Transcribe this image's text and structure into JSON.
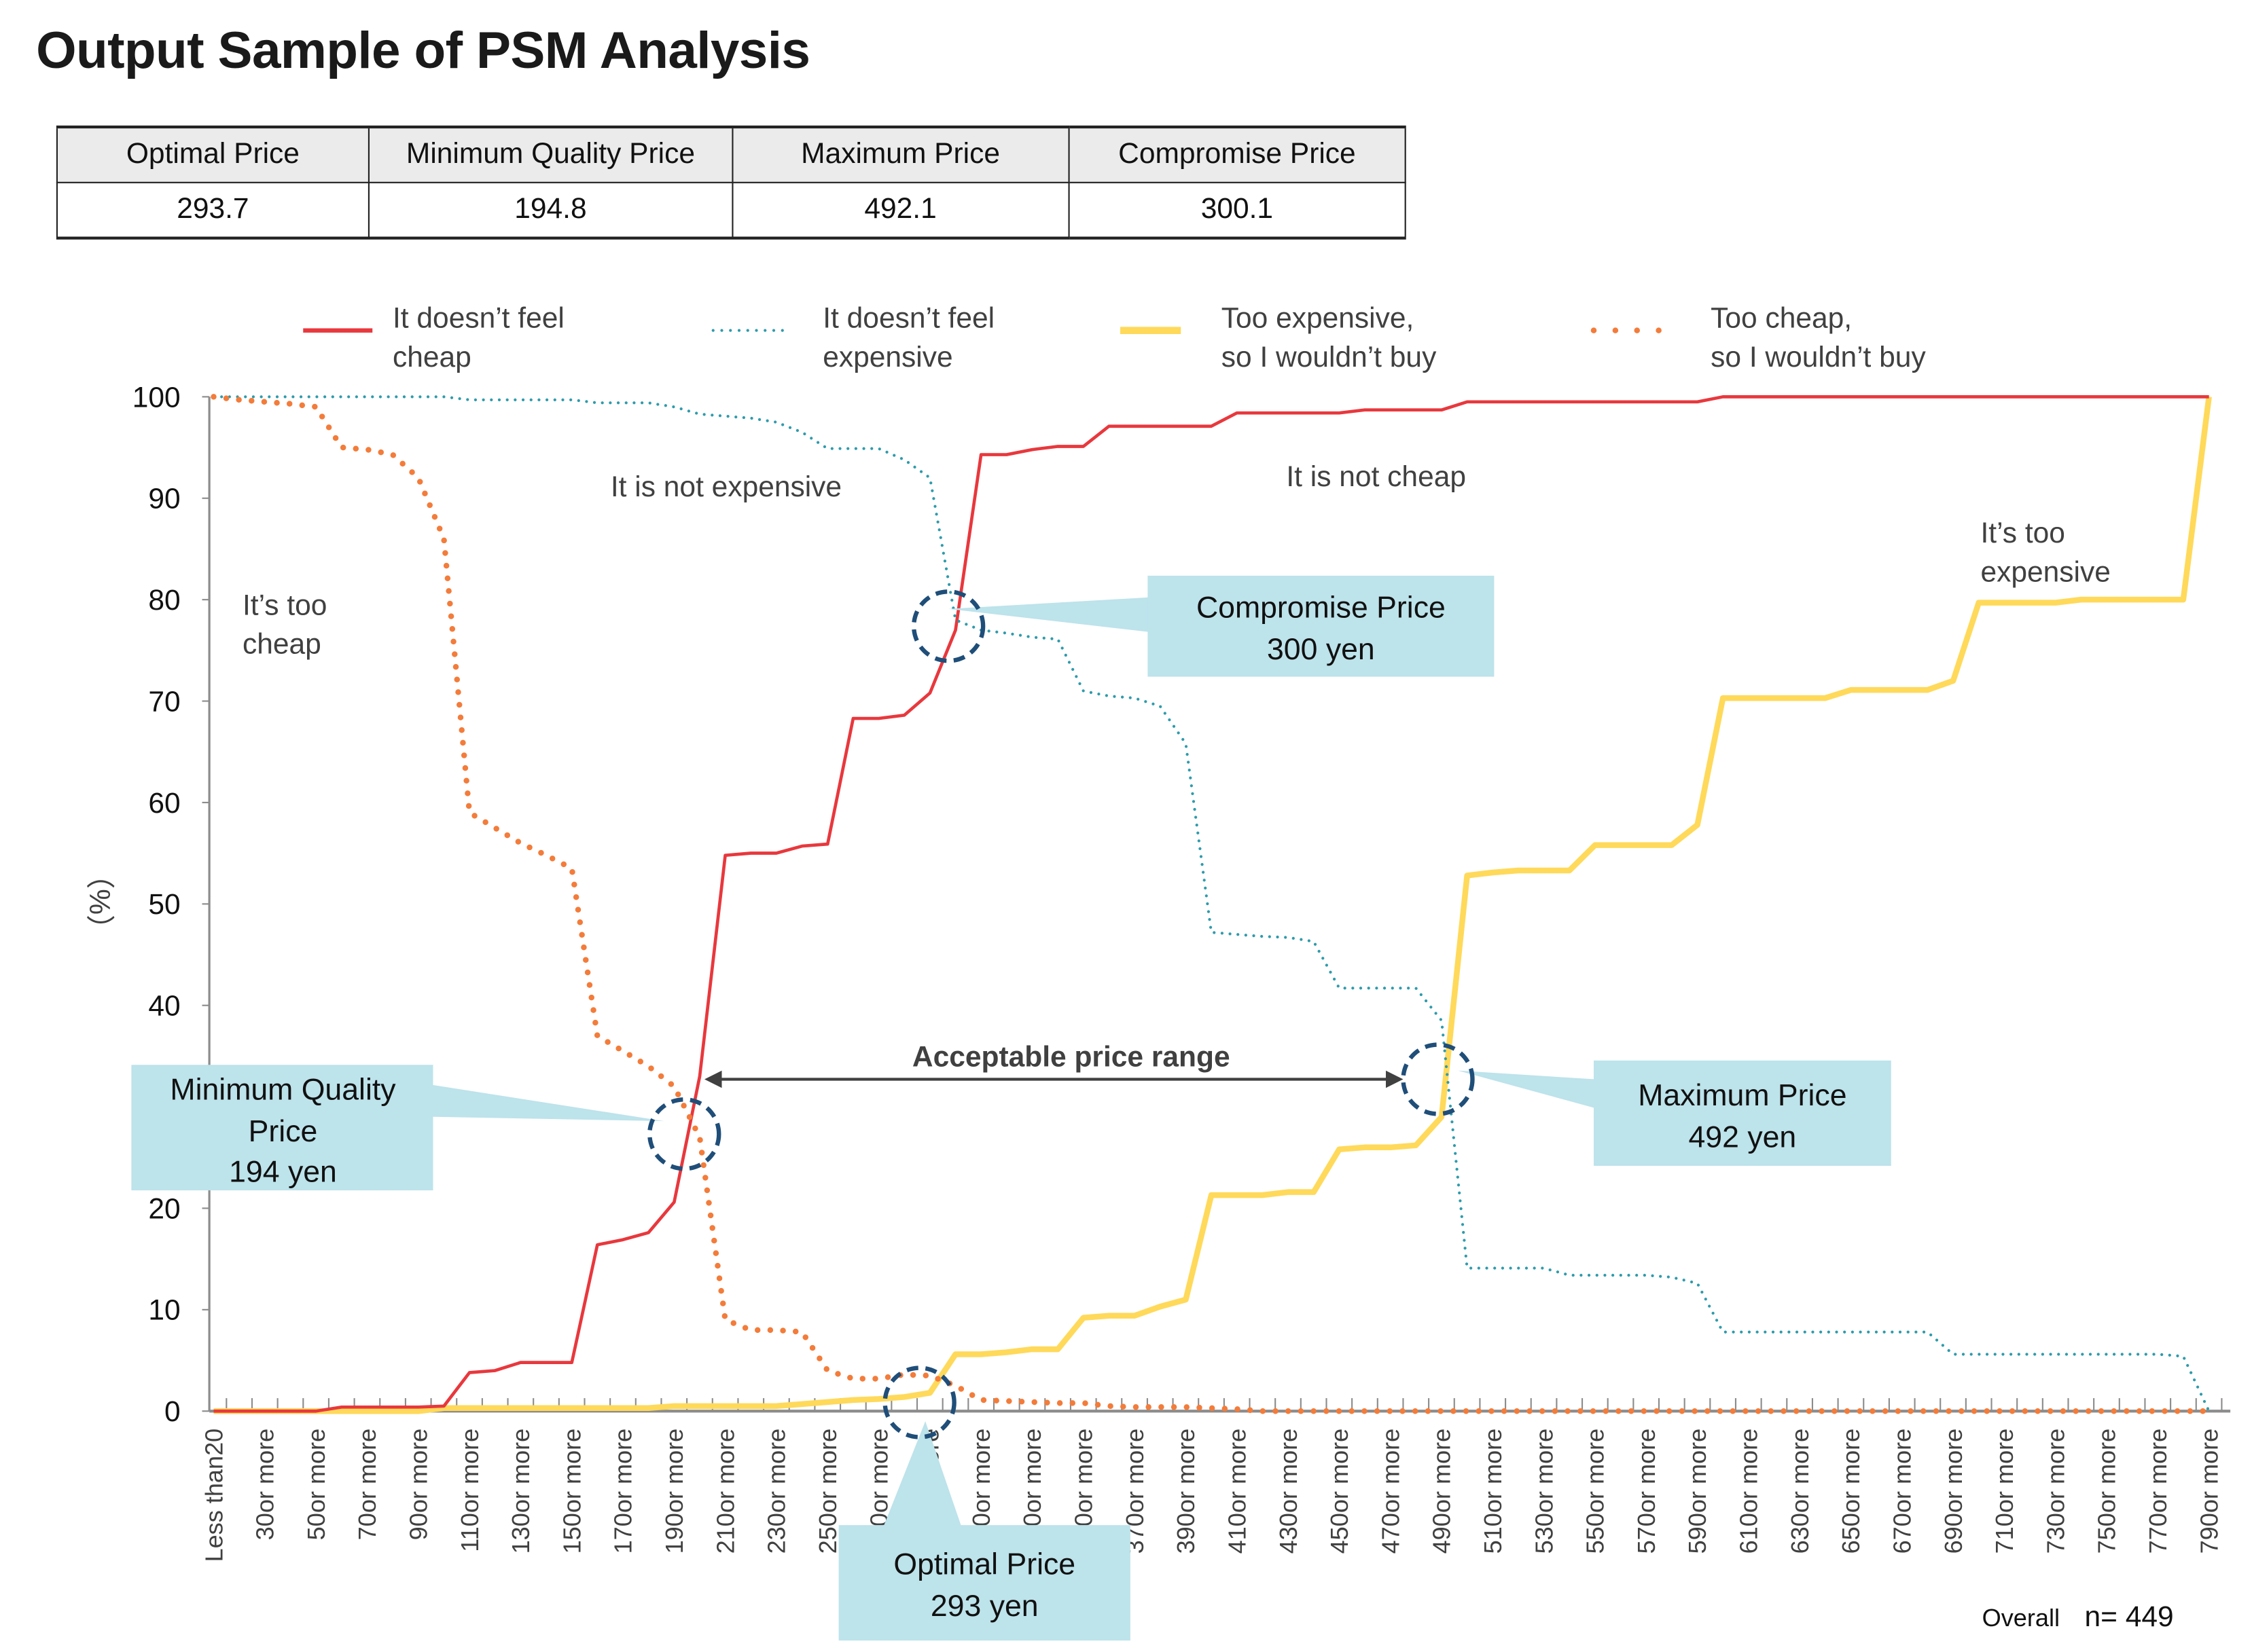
{
  "title": "Output Sample of PSM Analysis",
  "summary_table": {
    "headers": [
      "Optimal Price",
      "Minimum Quality Price",
      "Maximum Price",
      "Compromise Price"
    ],
    "values": [
      "293.7",
      "194.8",
      "492.1",
      "300.1"
    ]
  },
  "legend": [
    {
      "line1": "It doesn’t feel",
      "line2": "cheap"
    },
    {
      "line1": "It doesn’t feel",
      "line2": "expensive"
    },
    {
      "line1": "Too expensive,",
      "line2": "so I wouldn’t buy"
    },
    {
      "line1": "Too cheap,",
      "line2": "so I wouldn’t buy"
    }
  ],
  "annotations": {
    "too_cheap": {
      "line1": "It’s too",
      "line2": "cheap"
    },
    "not_expensive": "It is not expensive",
    "not_cheap": "It is not cheap",
    "too_expensive": {
      "line1": "It’s too",
      "line2": "expensive"
    },
    "acceptable_range": "Acceptable price range",
    "compromise": {
      "line1": "Compromise Price",
      "line2": "300 yen"
    },
    "minimum_quality": {
      "line1": "Minimum Quality",
      "line2": "Price",
      "line3": "194 yen"
    },
    "maximum": {
      "line1": "Maximum Price",
      "line2": "492 yen"
    },
    "optimal": {
      "line1": "Optimal Price",
      "line2": "293 yen"
    },
    "sample_label": "Overall",
    "sample_n": "n= 449"
  },
  "colors": {
    "not_cheap": "#e8383d",
    "not_expensive": "#2e9bab",
    "too_expensive": "#ffd95a",
    "too_cheap": "#f37c3a",
    "callout_fill": "#bde3eb",
    "circle": "#1f4e79"
  },
  "chart_data": {
    "type": "line",
    "ylabel": "（%）",
    "ylim": [
      0,
      100
    ],
    "yticks": [
      "0",
      "10",
      "20",
      "30",
      "40",
      "50",
      "60",
      "70",
      "80",
      "90",
      "100"
    ],
    "grid": false,
    "legend_position": "top",
    "x_tick_labels": [
      "Less than20",
      "30or more",
      "50or more",
      "70or more",
      "90or more",
      "110or more",
      "130or more",
      "150or more",
      "170or more",
      "190or more",
      "210or more",
      "230or more",
      "250or more",
      "270or more",
      "290or more",
      "310or more",
      "330or more",
      "350or more",
      "370or more",
      "390or more",
      "410or more",
      "430or more",
      "450or more",
      "470or more",
      "490or more",
      "510or more",
      "530or more",
      "550or more",
      "570or more",
      "590or more",
      "610or more",
      "630or more",
      "650or more",
      "670or more",
      "690or more",
      "710or more",
      "730or more",
      "750or more",
      "770or more",
      "790or more"
    ],
    "series": [
      {
        "name": "It doesn’t feel cheap",
        "style": "solid",
        "values": [
          0,
          0,
          0,
          0,
          0,
          0.4,
          0.4,
          0.4,
          0.4,
          0.5,
          3.8,
          4.0,
          4.8,
          4.8,
          4.8,
          16.4,
          16.9,
          17.6,
          20.6,
          33,
          54.8,
          55,
          55,
          55.7,
          55.9,
          68.3,
          68.3,
          68.6,
          70.8,
          77,
          94.3,
          94.3,
          94.8,
          95.1,
          95.1,
          97.1,
          97.1,
          97.1,
          97.1,
          97.1,
          98.4,
          98.4,
          98.4,
          98.4,
          98.4,
          98.7,
          98.7,
          98.7,
          98.7,
          99.5,
          99.5,
          99.5,
          99.5,
          99.5,
          99.5,
          99.5,
          99.5,
          99.5,
          99.5,
          100,
          100,
          100,
          100,
          100,
          100,
          100,
          100,
          100,
          100,
          100,
          100,
          100,
          100,
          100,
          100,
          100,
          100,
          100,
          100
        ]
      },
      {
        "name": "It doesn’t feel expensive",
        "style": "dotted",
        "values": [
          100,
          100,
          100,
          100,
          100,
          100,
          100,
          100,
          100,
          100,
          99.7,
          99.7,
          99.7,
          99.7,
          99.7,
          99.4,
          99.4,
          99.4,
          99.0,
          98.3,
          98.1,
          97.9,
          97.5,
          96.5,
          94.9,
          94.9,
          94.9,
          93.8,
          92,
          78,
          77,
          76.7,
          76.3,
          76.1,
          71,
          70.5,
          70.3,
          69.5,
          65.8,
          47.2,
          47,
          46.8,
          46.7,
          46.3,
          41.7,
          41.7,
          41.7,
          41.7,
          38.5,
          14.1,
          14.1,
          14.1,
          14.1,
          13.4,
          13.4,
          13.4,
          13.4,
          13.2,
          12.6,
          7.8,
          7.8,
          7.8,
          7.8,
          7.8,
          7.8,
          7.8,
          7.8,
          7.8,
          5.6,
          5.6,
          5.6,
          5.6,
          5.6,
          5.6,
          5.6,
          5.6,
          5.6,
          5.4,
          0
        ]
      },
      {
        "name": "Too expensive, so I wouldn’t buy",
        "style": "thick",
        "values": [
          0,
          0,
          0,
          0,
          0,
          0,
          0,
          0,
          0,
          0.3,
          0.3,
          0.3,
          0.3,
          0.3,
          0.3,
          0.3,
          0.3,
          0.3,
          0.5,
          0.5,
          0.5,
          0.5,
          0.5,
          0.7,
          0.9,
          1.1,
          1.2,
          1.4,
          1.8,
          5.6,
          5.6,
          5.8,
          6.1,
          6.1,
          9.2,
          9.4,
          9.4,
          10.3,
          11,
          21.3,
          21.3,
          21.3,
          21.6,
          21.6,
          25.8,
          26,
          26,
          26.2,
          29,
          52.8,
          53.1,
          53.3,
          53.3,
          53.3,
          55.8,
          55.8,
          55.8,
          55.8,
          57.8,
          70.3,
          70.3,
          70.3,
          70.3,
          70.3,
          71.1,
          71.1,
          71.1,
          71.1,
          72,
          79.7,
          79.7,
          79.7,
          79.7,
          80,
          80,
          80,
          80,
          80,
          100
        ]
      },
      {
        "name": "Too cheap, so I wouldn’t buy",
        "style": "dots",
        "values": [
          100,
          99.7,
          99.5,
          99.3,
          99,
          95,
          94.8,
          94.3,
          92,
          86,
          59,
          57.5,
          56,
          54.8,
          53.5,
          37,
          35.5,
          34,
          32,
          27,
          9,
          8,
          8,
          7.8,
          4,
          3.2,
          3.2,
          3.6,
          3.5,
          2.5,
          1.1,
          1,
          0.9,
          0.8,
          0.8,
          0.5,
          0.4,
          0.4,
          0.4,
          0.3,
          0.2,
          0,
          0,
          0,
          0,
          0,
          0,
          0,
          0,
          0,
          0,
          0,
          0,
          0,
          0,
          0,
          0,
          0,
          0,
          0,
          0,
          0,
          0,
          0,
          0,
          0,
          0,
          0,
          0,
          0,
          0,
          0,
          0,
          0,
          0,
          0,
          0,
          0,
          0
        ]
      }
    ]
  }
}
